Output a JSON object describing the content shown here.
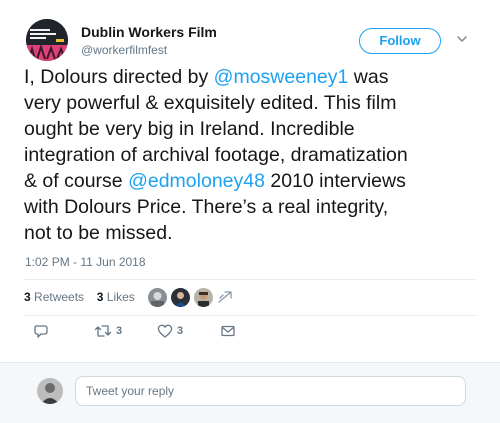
{
  "account": {
    "name": "Dublin Workers Film",
    "handle": "@workerfilmfest",
    "avatar_icon": "festival-logo-avatar"
  },
  "follow_label": "Follow",
  "tweet": {
    "lines": [
      [
        {
          "t": "I, Dolours directed by "
        },
        {
          "t": "@mosweeney1",
          "m": true
        },
        {
          "t": " was"
        }
      ],
      [
        {
          "t": "very powerful & exquisitely edited. This film"
        }
      ],
      [
        {
          "t": "ought be very big in Ireland. Incredible"
        }
      ],
      [
        {
          "t": "integration of archival footage, dramatization"
        }
      ],
      [
        {
          "t": "& of course "
        },
        {
          "t": "@edmoloney48",
          "m": true
        },
        {
          "t": " 2010 interviews"
        }
      ],
      [
        {
          "t": "with Dolours Price. There’s a real integrity,"
        }
      ],
      [
        {
          "t": "not to be missed."
        }
      ]
    ]
  },
  "timestamp": "1:02 PM - 11 Jun 2018",
  "stats": {
    "retweets_count": "3",
    "retweets_label": "Retweets",
    "likes_count": "3",
    "likes_label": "Likes"
  },
  "actions": {
    "reply_icon": "reply-icon",
    "retweet_icon": "retweet-icon",
    "retweet_count": "3",
    "like_icon": "heart-icon",
    "like_count": "3",
    "dm_icon": "envelope-icon"
  },
  "reply": {
    "placeholder": "Tweet your reply"
  },
  "colors": {
    "accent": "#1da1f2",
    "text": "#14171a",
    "secondary": "#657786",
    "divider": "#e6ecf0"
  }
}
